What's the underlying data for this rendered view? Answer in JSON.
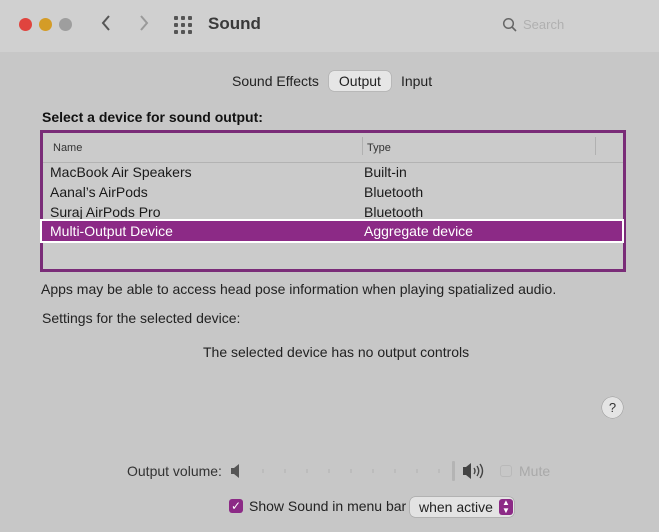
{
  "window": {
    "title": "Sound",
    "search_placeholder": "Search",
    "traffic_light_colors": [
      "#e0443e",
      "#d49c27",
      "#9e9e9e"
    ]
  },
  "tabs": [
    {
      "label": "Sound Effects",
      "active": false
    },
    {
      "label": "Output",
      "active": true
    },
    {
      "label": "Input",
      "active": false
    }
  ],
  "output": {
    "heading": "Select a device for sound output:",
    "columns": [
      "Name",
      "Type"
    ],
    "devices": [
      {
        "name": "MacBook Air Speakers",
        "type": "Built-in"
      },
      {
        "name": "Aanal’s AirPods",
        "type": "Bluetooth"
      },
      {
        "name": "Suraj AirPods Pro",
        "type": "Bluetooth"
      },
      {
        "name": "Multi-Output Device",
        "type": "Aggregate device",
        "selected": true
      }
    ],
    "spatial_note": "Apps may be able to access head pose information when playing spatialized audio.",
    "settings_label": "Settings for the selected device:",
    "no_controls_text": "The selected device has no output controls",
    "help_label": "?"
  },
  "volume": {
    "label": "Output volume:",
    "mute_label": "Mute",
    "level_fraction": 0.0,
    "enabled": false
  },
  "menu_bar": {
    "checkbox_label": "Show Sound in menu bar",
    "checked": true,
    "dropdown_value": "when active"
  },
  "colors": {
    "accent": "#8c2a86",
    "highlight_border": "#7a2c78",
    "background": "#c7c7c7"
  }
}
